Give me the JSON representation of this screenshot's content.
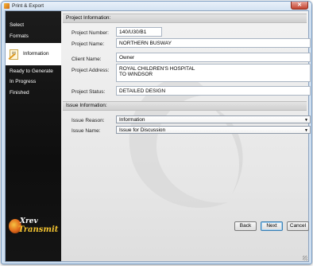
{
  "window": {
    "title": "Print & Export",
    "close_glyph": "✕"
  },
  "sidebar": {
    "items": [
      {
        "label": "Select",
        "active": false
      },
      {
        "label": "Formats",
        "active": false
      },
      {
        "label": "Information",
        "active": true
      },
      {
        "label": "Ready to Generate",
        "active": false
      },
      {
        "label": "In Progress",
        "active": false
      },
      {
        "label": "Finished",
        "active": false
      }
    ],
    "logo": {
      "line1": "Xrev",
      "line2": "Transmit"
    }
  },
  "project_info": {
    "header": "Project Information:",
    "number_label": "Project Number:",
    "number_value": "140/U30/B1",
    "name_label": "Project Name:",
    "name_value": "NORTHERN BUSWAY",
    "client_label": "Client Name:",
    "client_value": "Owner",
    "address_label": "Project Address:",
    "address_value": "ROYAL CHILDREN'S HOSPITAL\nTO WINDSOR",
    "status_label": "Project Status:",
    "status_value": "DETAILED DESIGN"
  },
  "issue_info": {
    "header": "Issue Information:",
    "reason_label": "Issue Reason:",
    "reason_value": "Information",
    "name_label": "Issue Name:",
    "name_value": "Issue for Discussion"
  },
  "buttons": {
    "back": "Back",
    "next": "Next",
    "cancel": "Cancel"
  }
}
